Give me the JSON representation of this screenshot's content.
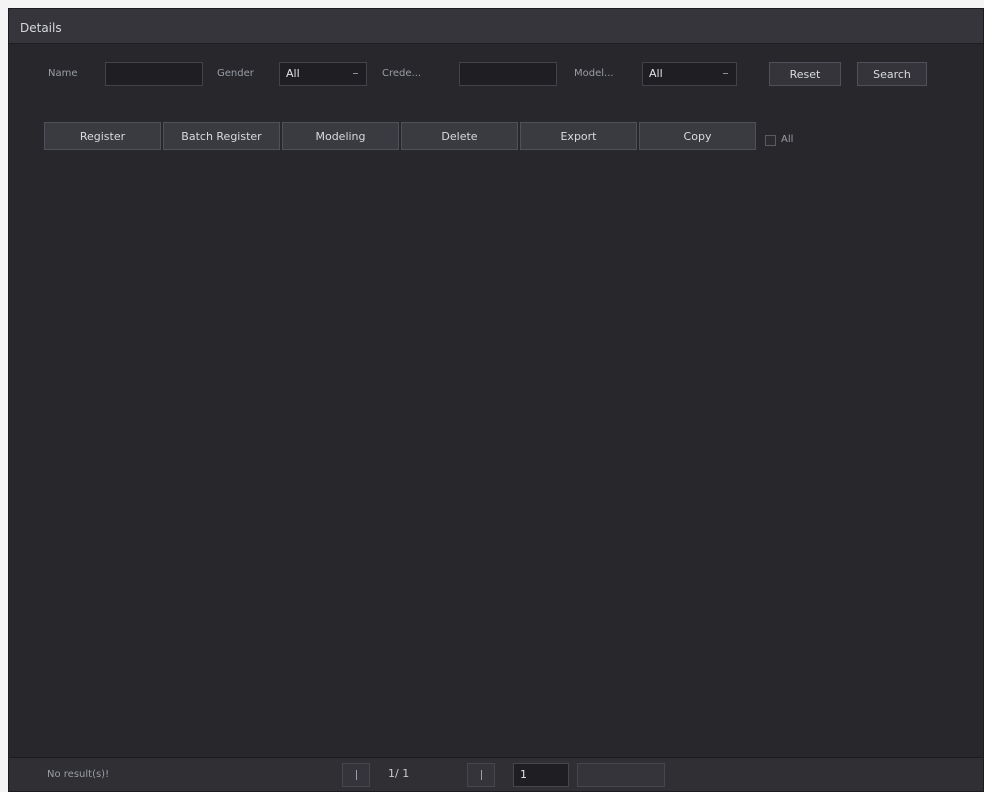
{
  "window": {
    "title": "Details"
  },
  "search": {
    "name_label": "Name",
    "name_value": "",
    "gender_label": "Gender",
    "gender_value": "All",
    "credential_label": "Crede...",
    "credential_value": "",
    "modeling_label": "Model...",
    "modeling_value": "All",
    "reset_label": "Reset",
    "search_label": "Search"
  },
  "toolbar": {
    "register_label": "Register",
    "batch_register_label": "Batch Register",
    "modeling_label": "Modeling",
    "delete_label": "Delete",
    "export_label": "Export",
    "copy_label": "Copy",
    "select_all_label": "All",
    "select_all_checked": false
  },
  "footer": {
    "status": "No result(s)!",
    "page_indicator": "1/ 1",
    "goto_page_value": "1"
  }
}
